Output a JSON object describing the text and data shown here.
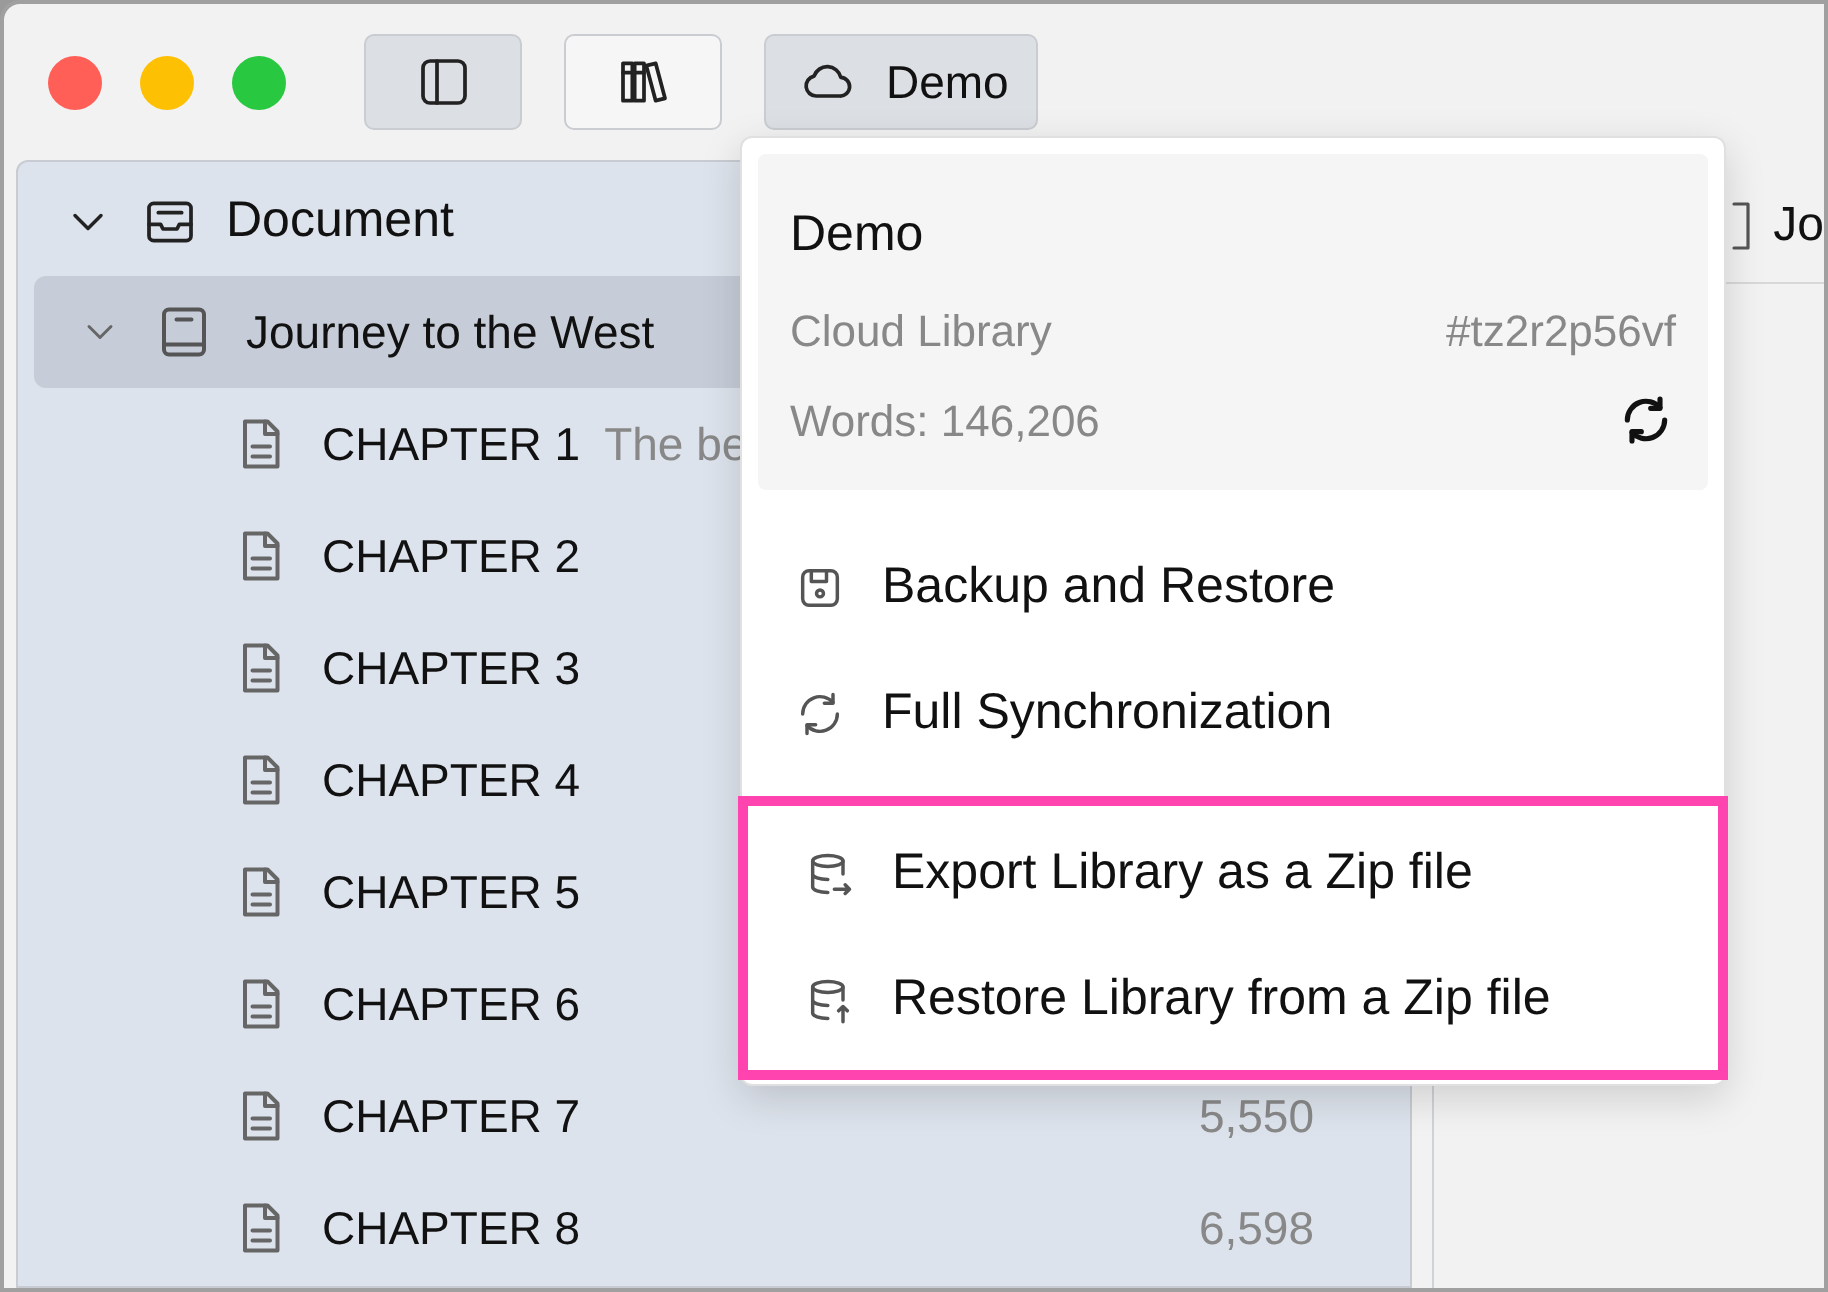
{
  "toolbar": {
    "buttons": [
      {
        "kind": "sidebar",
        "selected": true
      },
      {
        "kind": "library",
        "selected": false
      },
      {
        "kind": "cloud",
        "label": "Demo",
        "selected": true
      }
    ]
  },
  "sidebar": {
    "root": {
      "label": "Document",
      "expanded": true,
      "children": [
        {
          "label": "Journey to the West",
          "expanded": true,
          "selected": true,
          "children": [
            {
              "label": "CHAPTER 1",
              "subtitle": "The be"
            },
            {
              "label": "CHAPTER 2"
            },
            {
              "label": "CHAPTER 3"
            },
            {
              "label": "CHAPTER 4"
            },
            {
              "label": "CHAPTER 5"
            },
            {
              "label": "CHAPTER 6"
            },
            {
              "label": "CHAPTER 7",
              "words": "5,550"
            },
            {
              "label": "CHAPTER 8",
              "words": "6,598"
            }
          ]
        }
      ]
    }
  },
  "editor": {
    "tab": {
      "label": "Jo"
    }
  },
  "menu": {
    "library": {
      "name": "Demo",
      "type": "Cloud Library",
      "id": "#tz2r2p56vf",
      "words": "Words: 146,206"
    },
    "groups": [
      {
        "highlighted": false,
        "items": [
          {
            "kind": "save",
            "label": "Backup and Restore"
          },
          {
            "kind": "sync",
            "label": "Full Synchronization"
          }
        ]
      },
      {
        "highlighted": true,
        "items": [
          {
            "kind": "db-export",
            "label": "Export Library as a Zip file"
          },
          {
            "kind": "db-import",
            "label": "Restore Library from a Zip file"
          }
        ]
      }
    ]
  }
}
